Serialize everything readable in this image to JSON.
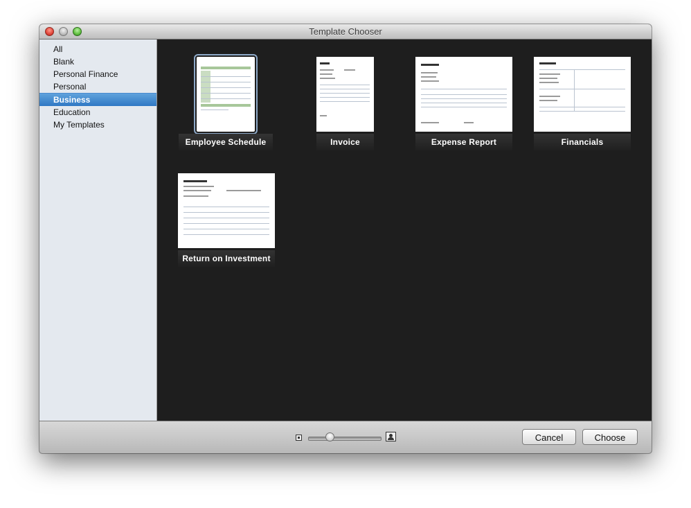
{
  "window": {
    "title": "Template Chooser"
  },
  "sidebar": {
    "items": [
      {
        "label": "All"
      },
      {
        "label": "Blank"
      },
      {
        "label": "Personal Finance"
      },
      {
        "label": "Personal"
      },
      {
        "label": "Business",
        "selected": true
      },
      {
        "label": "Education"
      },
      {
        "label": "My Templates"
      }
    ]
  },
  "templates": [
    {
      "label": "Employee Schedule",
      "selected": true
    },
    {
      "label": "Invoice"
    },
    {
      "label": "Expense Report"
    },
    {
      "label": "Financials"
    },
    {
      "label": "Return on Investment"
    }
  ],
  "footer": {
    "cancel_label": "Cancel",
    "choose_label": "Choose",
    "zoom_slider_value": 0.3,
    "small_icon": "small-thumbnail-icon",
    "large_icon": "large-thumbnail-icon"
  },
  "colors": {
    "selection": "#2f78c4",
    "grid_background": "#1e1e1e",
    "sidebar_background": "#e4e9ef"
  }
}
